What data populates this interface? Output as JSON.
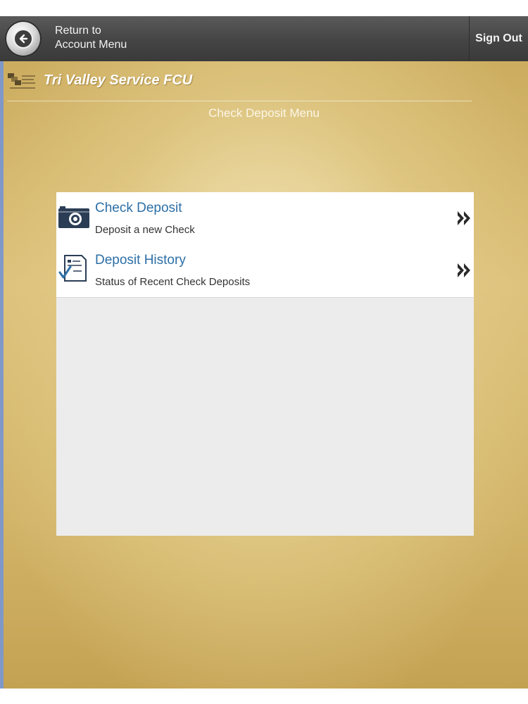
{
  "header": {
    "back_line1": "Return to",
    "back_line2": "Account Menu",
    "signout_label": "Sign Out"
  },
  "brand": {
    "name": "Tri Valley Service FCU"
  },
  "page": {
    "title": "Check Deposit Menu"
  },
  "menu": {
    "items": [
      {
        "title": "Check Deposit",
        "subtitle": "Deposit a new Check",
        "icon": "camera-icon"
      },
      {
        "title": "Deposit History",
        "subtitle": "Status of Recent Check Deposits",
        "icon": "document-check-icon"
      }
    ]
  },
  "colors": {
    "topbar": "#444444",
    "link_blue": "#2d6fa6",
    "background_gold": "#d2b468"
  }
}
